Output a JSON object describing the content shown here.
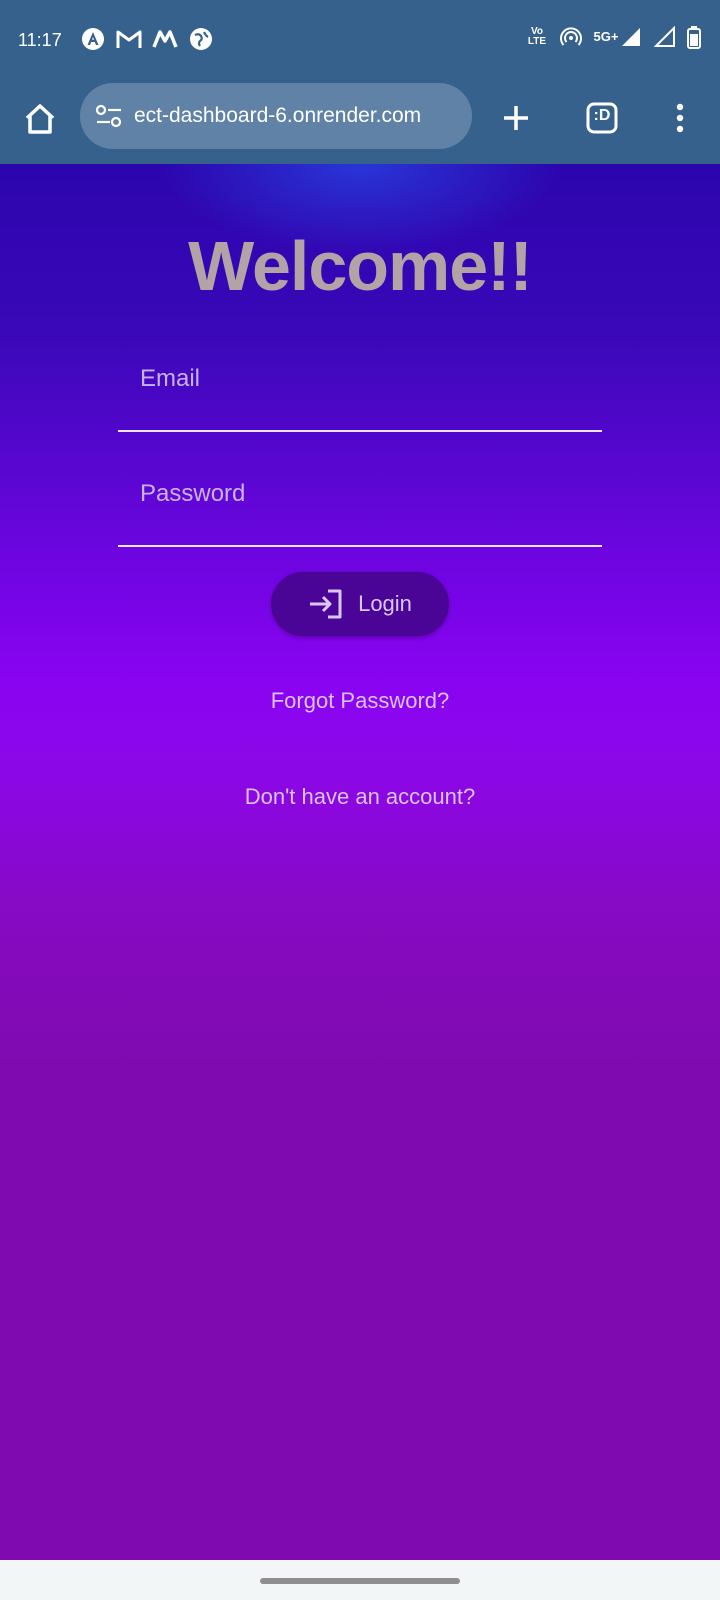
{
  "status_bar": {
    "time": "11:17",
    "left_icons": [
      "app-a-icon",
      "gmail-icon",
      "m-app-icon",
      "vpn-globe-icon"
    ],
    "volte_label_top": "Vo",
    "volte_label_bottom": "LTE",
    "network_label": "5G+",
    "right_icons": [
      "volte-icon",
      "hotspot-icon",
      "signal-5g-icon",
      "signal-icon",
      "battery-icon"
    ]
  },
  "browser": {
    "url": "ect-dashboard-6.onrender.com",
    "tab_count_label": ":D"
  },
  "page": {
    "title": "Welcome!!",
    "email_placeholder": "Email",
    "password_placeholder": "Password",
    "login_label": "Login",
    "forgot_password_label": "Forgot Password?",
    "signup_prompt_label": "Don't have an account?"
  },
  "colors": {
    "status_bar_bg": "#37618d",
    "url_bar_bg": "#5f82a6",
    "background_top": "#2c05ad",
    "background_mid": "#8a04f2",
    "background_bottom": "#7f0bb0",
    "title_color": "#b3a2a6",
    "login_button_bg": "#4a0496"
  }
}
